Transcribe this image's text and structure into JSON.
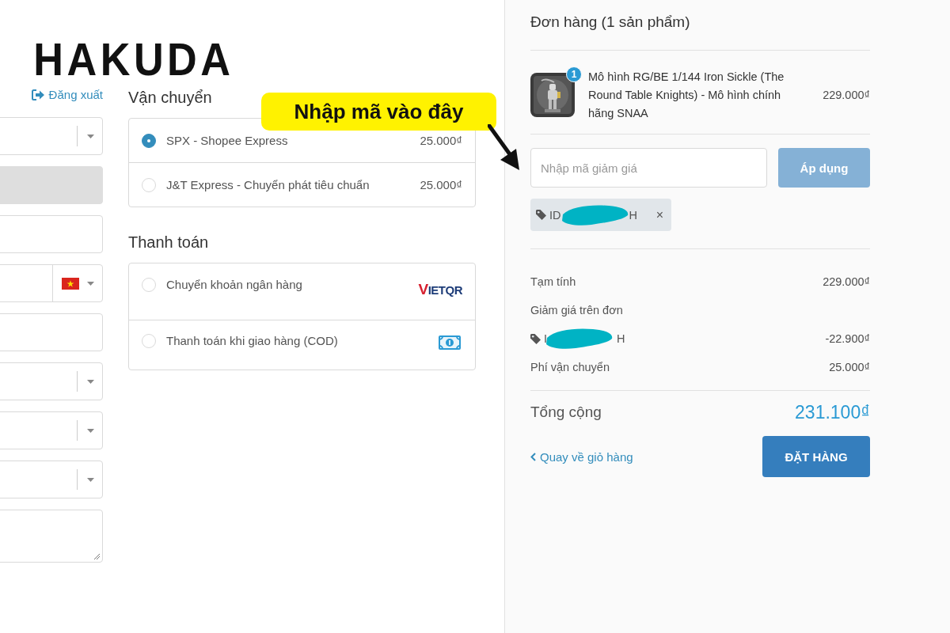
{
  "logo": {
    "text": "HAKUDA"
  },
  "logout_link": {
    "label": "Đăng xuất"
  },
  "form_fields": [
    {
      "kind": "select",
      "disabled": false
    },
    {
      "kind": "input",
      "disabled": true
    },
    {
      "kind": "input",
      "disabled": false
    },
    {
      "kind": "phone",
      "disabled": false
    },
    {
      "kind": "input",
      "disabled": false
    },
    {
      "kind": "select",
      "disabled": false
    },
    {
      "kind": "select",
      "disabled": false
    },
    {
      "kind": "select",
      "disabled": false
    },
    {
      "kind": "textarea",
      "disabled": false
    }
  ],
  "shipping": {
    "title": "Vận chuyển",
    "options": [
      {
        "label": "SPX - Shopee Express",
        "price": "25.000₫",
        "selected": true
      },
      {
        "label": "J&T Express - Chuyển phát tiêu chuẩn",
        "price": "25.000₫",
        "selected": false
      }
    ]
  },
  "payment": {
    "title": "Thanh toán",
    "options": [
      {
        "label": "Chuyển khoản ngân hàng",
        "kind": "vietqr",
        "logo_mark": "V",
        "logo_text": "IETQR",
        "selected": false
      },
      {
        "label": "Thanh toán khi giao hàng (COD)",
        "kind": "cash",
        "selected": false
      }
    ]
  },
  "order": {
    "title": "Đơn hàng (1 sản phẩm)",
    "product": {
      "name": "Mô hình RG/BE 1/144 Iron Sickle (The Round Table Knights) - Mô hình chính hãng SNAA",
      "quantity": "1",
      "price": "229.000₫"
    },
    "discount": {
      "placeholder": "Nhập mã giảm giá",
      "button": "Áp dụng",
      "applied_code_start": "ID",
      "applied_code_end": "H",
      "remove": "×"
    },
    "summary": [
      {
        "kind": "line",
        "label": "Tạm tính",
        "value": "229.000₫"
      },
      {
        "kind": "heading",
        "label": "Giảm giá trên đơn"
      },
      {
        "kind": "coupon",
        "code_start": "I",
        "code_end": "H",
        "value": "-22.900₫"
      },
      {
        "kind": "line",
        "label": "Phí vận chuyển",
        "value": "25.000₫"
      }
    ],
    "total": {
      "label": "Tổng cộng",
      "value": "231.100₫"
    },
    "back_link": "Quay về giỏ hàng",
    "place_order": "ĐẶT HÀNG"
  },
  "annotation": {
    "text": "Nhập mã vào đây"
  }
}
